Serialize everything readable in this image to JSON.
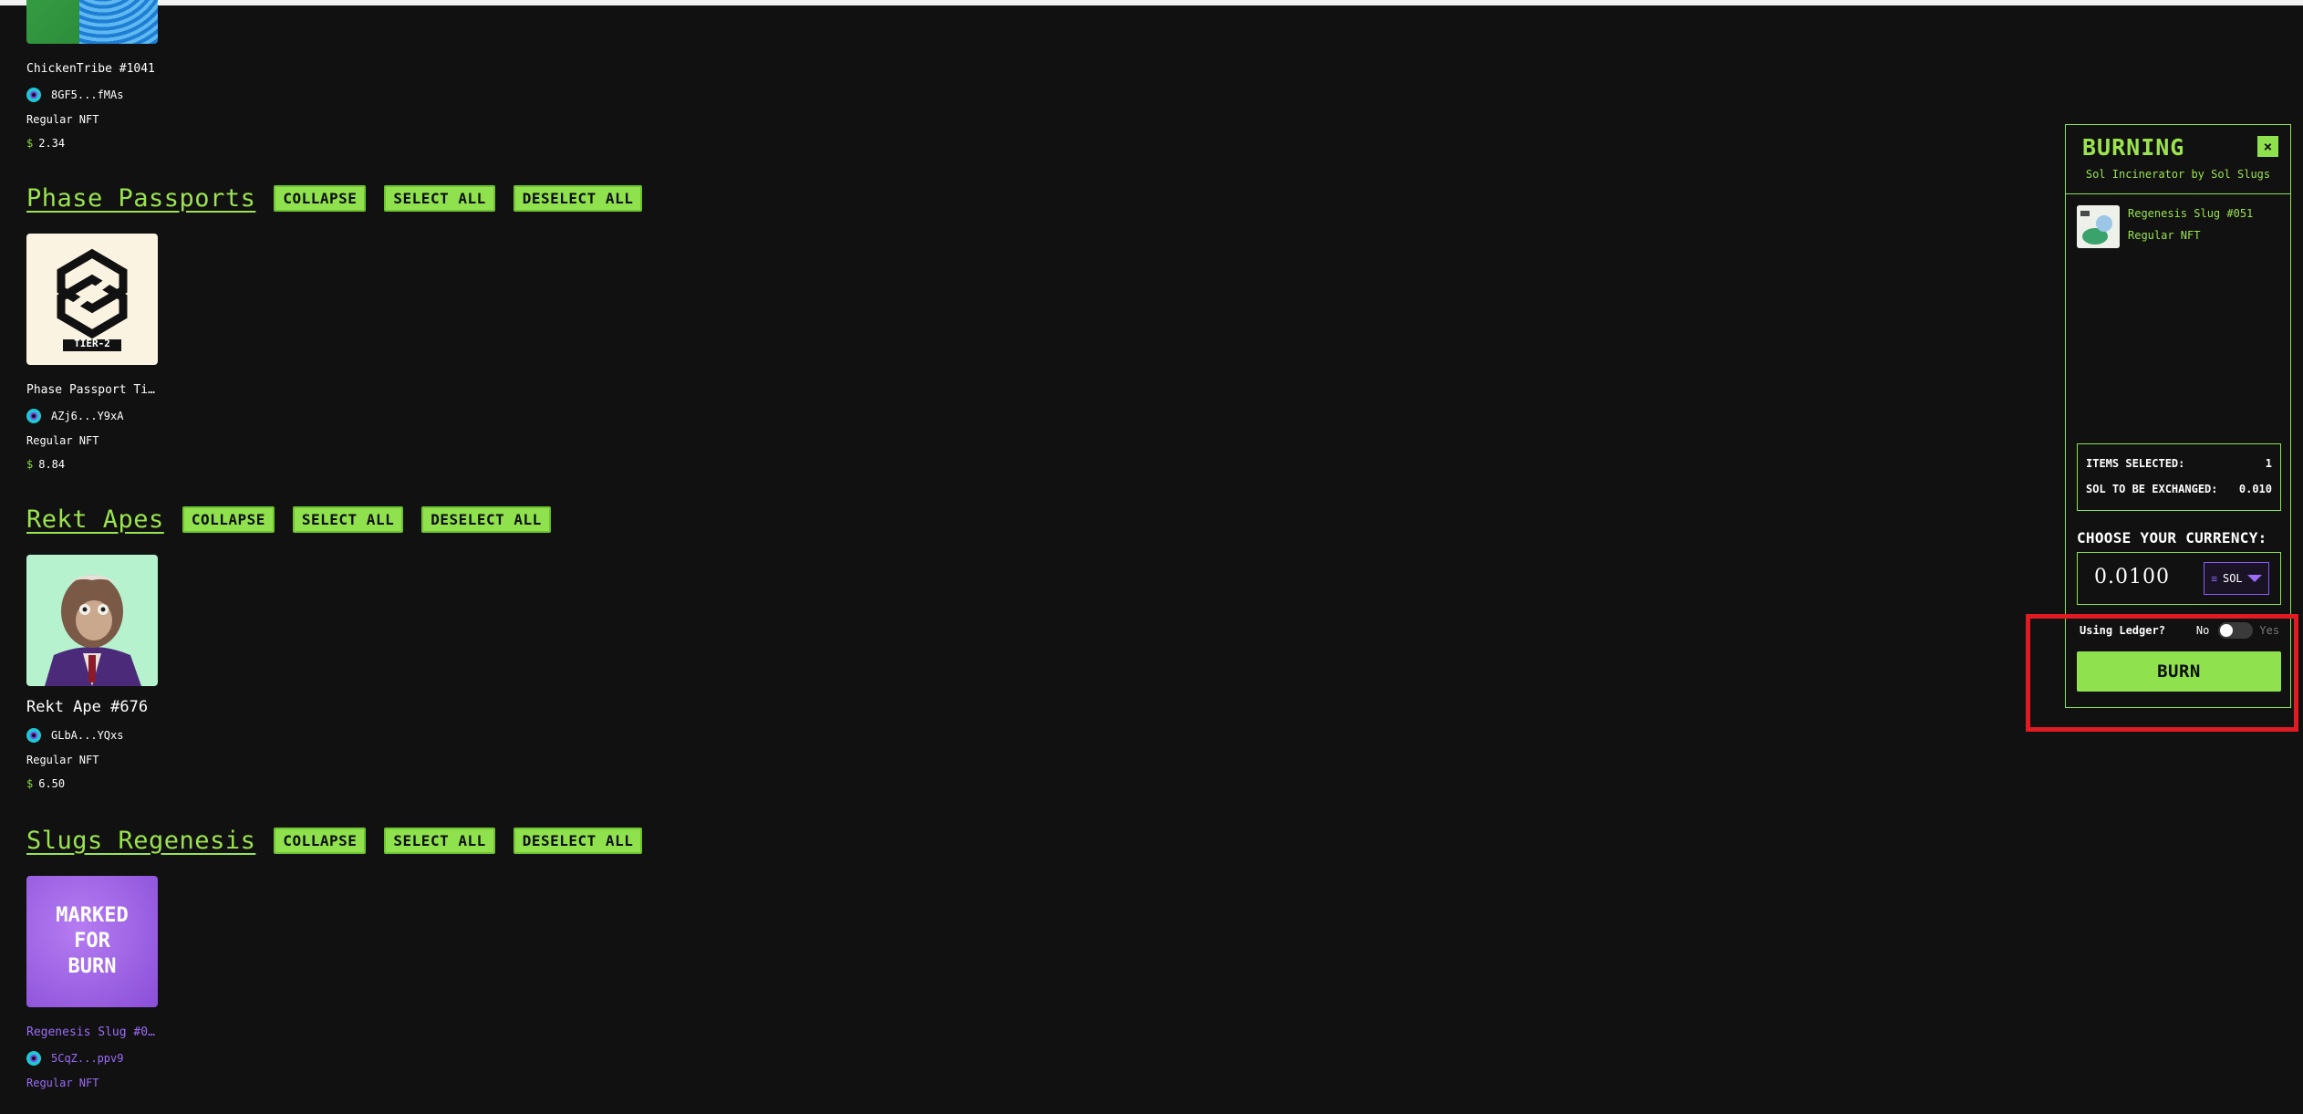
{
  "cards": {
    "chicken": {
      "name": "ChickenTribe #1041",
      "address": "8GF5...fMAs",
      "type": "Regular NFT",
      "price": "2.34",
      "currency_symbol": "$"
    },
    "phase": {
      "name": "Phase Passport Tier…",
      "address": "AZj6...Y9xA",
      "type": "Regular NFT",
      "price": "8.84",
      "currency_symbol": "$",
      "thumb_text": "TIER-2"
    },
    "rekt": {
      "name": "Rekt Ape #676",
      "address": "GLbA...YQxs",
      "type": "Regular NFT",
      "price": "6.50",
      "currency_symbol": "$"
    },
    "slug": {
      "name": "Regenesis Slug #051",
      "address": "5CqZ...ppv9",
      "type": "Regular NFT",
      "thumb_line1": "MARKED",
      "thumb_line2": "FOR",
      "thumb_line3": "BURN"
    }
  },
  "collections": {
    "phase": {
      "title": "Phase Passports"
    },
    "rekt": {
      "title": "Rekt Apes"
    },
    "slugs": {
      "title": "Slugs Regenesis"
    },
    "buttons": {
      "collapse": "COLLAPSE",
      "select_all": "SELECT ALL",
      "deselect_all": "DESELECT ALL"
    }
  },
  "panel": {
    "title": "BURNING",
    "close": "×",
    "subtitle": "Sol Incinerator by Sol Slugs",
    "selected_item": {
      "name": "Regenesis Slug #051",
      "type": "Regular NFT"
    },
    "items_selected_label": "ITEMS SELECTED:",
    "items_selected_value": "1",
    "sol_exchanged_label": "SOL TO BE EXCHANGED:",
    "sol_exchanged_value": "0.010",
    "choose_currency": "CHOOSE YOUR CURRENCY:",
    "amount": "0.0100",
    "currency": "SOL",
    "currency_icon": "≡",
    "ledger_label": "Using Ledger?",
    "ledger_no": "No",
    "ledger_yes": "Yes",
    "burn_label": "BURN"
  },
  "colors": {
    "accent": "#8fe24d",
    "purple": "#9b6cf7",
    "highlight": "#e01b24",
    "background": "#111111"
  }
}
